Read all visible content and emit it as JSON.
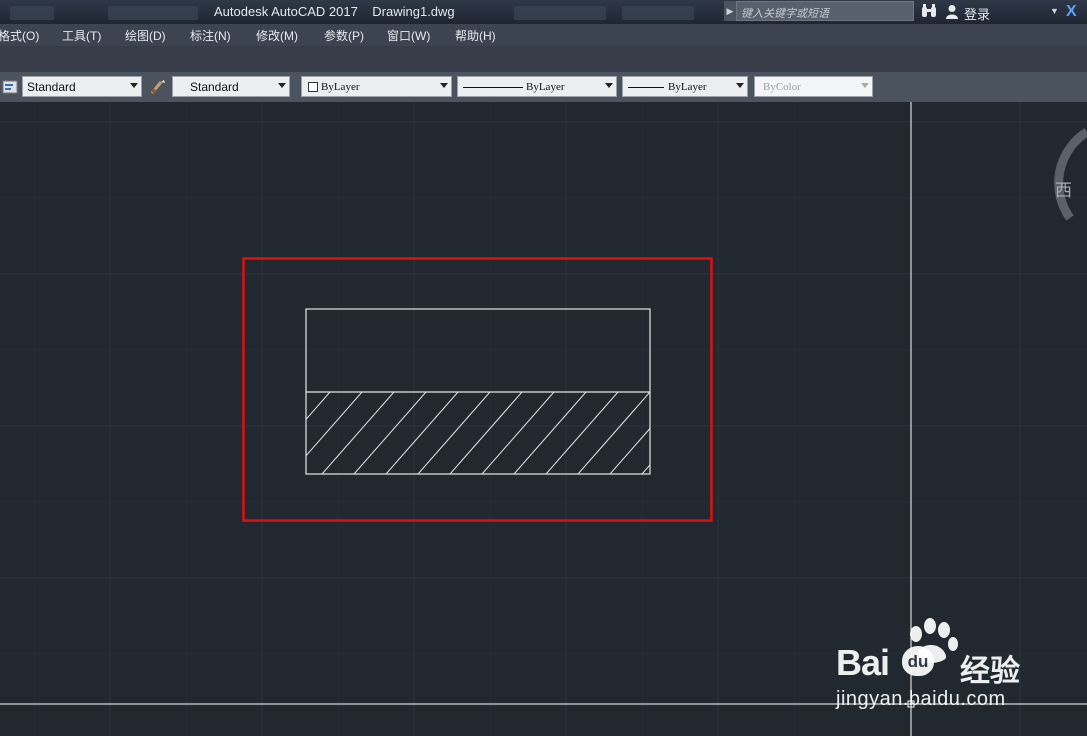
{
  "app": {
    "title": "Autodesk AutoCAD 2017",
    "document": "Drawing1.dwg",
    "search_placeholder": "键入关键字或短语",
    "login_label": "登录"
  },
  "menu": [
    {
      "label": "格式(O)"
    },
    {
      "label": "工具(T)"
    },
    {
      "label": "绘图(D)"
    },
    {
      "label": "标注(N)"
    },
    {
      "label": "修改(M)"
    },
    {
      "label": "参数(P)"
    },
    {
      "label": "窗口(W)"
    },
    {
      "label": "帮助(H)"
    }
  ],
  "toolbar": {
    "text_style": "Standard",
    "dim_style": "Standard",
    "layer_color": "ByLayer",
    "linetype": "ByLayer",
    "lineweight": "ByLayer",
    "plot_style": "ByColor"
  },
  "viewcube": {
    "west_label": "西"
  },
  "watermark": {
    "brand": "Bai",
    "brand_suffix": "经验",
    "du": "du",
    "url": "jingyan.baidu.com"
  },
  "colors": {
    "canvas_bg": "#212830",
    "grid_line": "#2c3440",
    "highlight_box": "#e01010",
    "geometry": "#e6e6e6",
    "crosshair": "#ffffff"
  }
}
